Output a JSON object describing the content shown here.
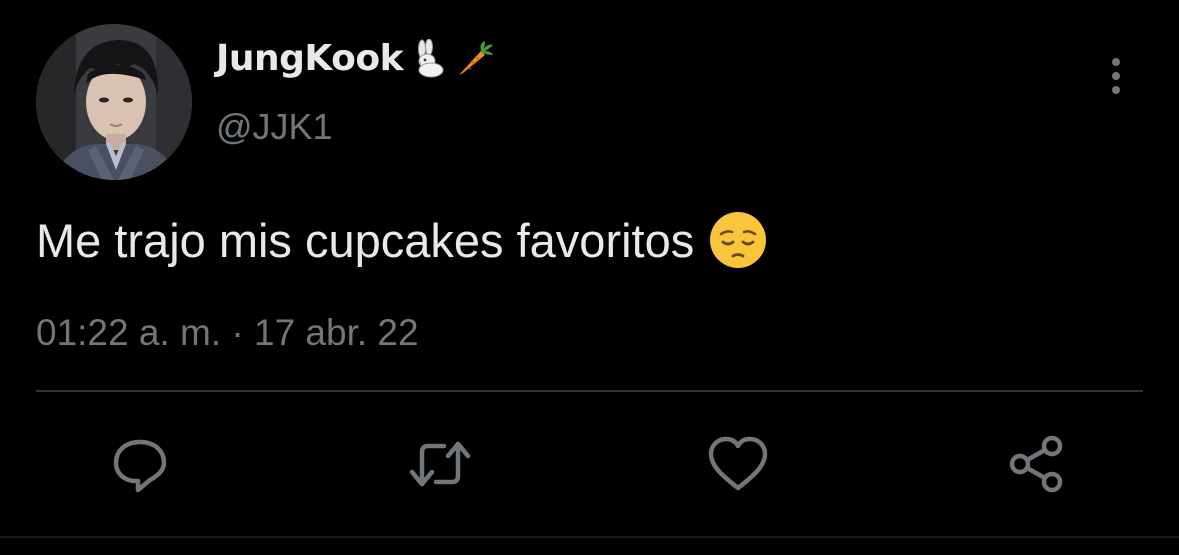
{
  "tweet": {
    "author": {
      "display_name": "JungKook",
      "name_emojis": [
        "rabbit-emoji",
        "carrot-emoji"
      ],
      "handle": "@JJK1"
    },
    "text": "Me trajo mis cupcakes favoritos",
    "text_emoji": "pensive-face-emoji",
    "timestamp": "01:22 a. m. · 17 abr. 22"
  },
  "actions": [
    {
      "name": "reply",
      "icon": "speech-bubble-icon"
    },
    {
      "name": "retweet",
      "icon": "retweet-icon"
    },
    {
      "name": "like",
      "icon": "heart-icon"
    },
    {
      "name": "share",
      "icon": "share-icon"
    }
  ],
  "menu": {
    "icon": "vertical-ellipsis-icon"
  },
  "colors": {
    "background": "#000000",
    "primary_text": "#e7e9ea",
    "secondary_text": "#71767b",
    "divider": "#2f3336"
  }
}
